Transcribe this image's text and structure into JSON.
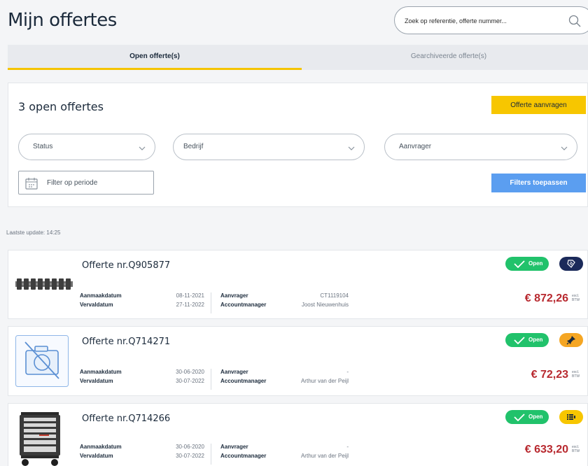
{
  "page": {
    "title": "Mijn offertes"
  },
  "search": {
    "placeholder": "Zoek op referentie, offerte nummer..."
  },
  "tabs": [
    {
      "label": "Open offerte(s)",
      "active": true
    },
    {
      "label": "Gearchiveerde offerte(s)",
      "active": false
    }
  ],
  "summary": {
    "open_count": "3 open offertes",
    "request_button": "Offerte aanvragen"
  },
  "filters": {
    "status": "Status",
    "company": "Bedrijf",
    "requester": "Aanvrager",
    "period": "Filter op periode",
    "apply_button": "Filters toepassen"
  },
  "last_update": "Laatste update: 14:25",
  "labels": {
    "created": "Aanmaakdatum",
    "expires": "Vervaldatum",
    "requester": "Aanvrager",
    "account_manager": "Accountmanager",
    "open": "Open",
    "vat": "excl. BTW"
  },
  "quotes": [
    {
      "title": "Offerte nr.Q905877",
      "created": "08-11-2021",
      "expires": "27-11-2022",
      "requester": "CT1119104",
      "account_manager": "Joost Nieuwenhuis",
      "price": "€ 872,26",
      "thumb": "chain-image",
      "status_icon": "tag-icon"
    },
    {
      "title": "Offerte nr.Q714271",
      "created": "30-06-2020",
      "expires": "30-07-2022",
      "requester": "-",
      "account_manager": "Arthur van der Peijl",
      "price": "€ 72,23",
      "thumb": "no-image-camera-icon",
      "status_icon": "pin-icon"
    },
    {
      "title": "Offerte nr.Q714266",
      "created": "30-06-2020",
      "expires": "30-07-2022",
      "requester": "-",
      "account_manager": "Arthur van der Peijl",
      "price": "€ 633,20",
      "thumb": "tool-cabinet-image",
      "status_icon": "list-icon"
    }
  ],
  "colors": {
    "accent_yellow": "#f7c600",
    "primary_blue": "#5b9ef0",
    "open_green": "#21c26b",
    "price_red": "#b8292f",
    "navy": "#1b2a5a",
    "orange": "#f5a623"
  }
}
